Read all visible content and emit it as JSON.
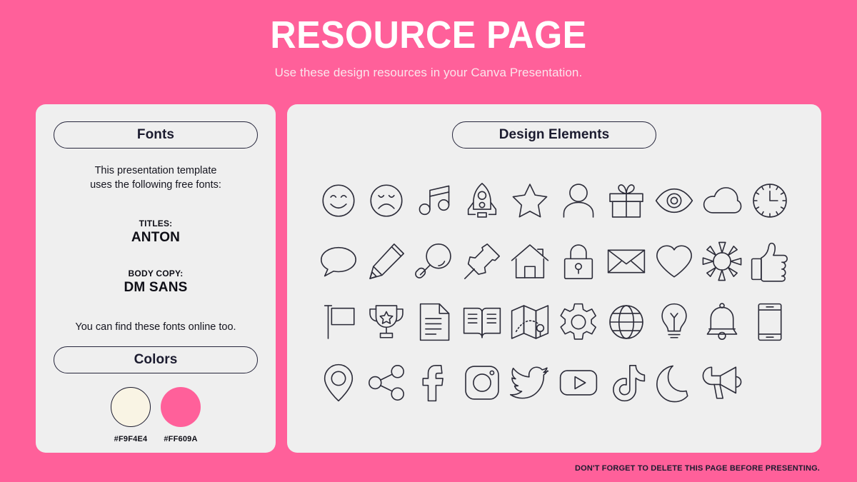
{
  "header": {
    "title": "RESOURCE PAGE",
    "subtitle": "Use these design resources in your Canva Presentation."
  },
  "fonts_panel": {
    "heading": "Fonts",
    "intro_line_1": "This presentation template",
    "intro_line_2": "uses the following free fonts:",
    "titles_label": "TITLES:",
    "titles_value": "ANTON",
    "body_label": "BODY COPY:",
    "body_value": "DM SANS",
    "outro": "You can find these fonts online too."
  },
  "colors_panel": {
    "heading": "Colors",
    "swatches": [
      {
        "hex": "#F9F4E4",
        "outlined": true
      },
      {
        "hex": "#FF609A",
        "outlined": false
      }
    ]
  },
  "design_panel": {
    "heading": "Design Elements",
    "icons": [
      "smiley-face-icon",
      "sad-face-icon",
      "music-note-icon",
      "rocket-icon",
      "star-icon",
      "user-icon",
      "gift-icon",
      "eye-icon",
      "cloud-icon",
      "clock-icon",
      "speech-bubble-icon",
      "pencil-icon",
      "magnifier-icon",
      "pushpin-icon",
      "house-icon",
      "lock-icon",
      "envelope-icon",
      "heart-icon",
      "sun-icon",
      "thumbs-up-icon",
      "flag-icon",
      "trophy-icon",
      "document-icon",
      "open-book-icon",
      "map-icon",
      "gear-icon",
      "globe-icon",
      "lightbulb-icon",
      "bell-icon",
      "mobile-phone-icon",
      "location-pin-icon",
      "share-icon",
      "facebook-icon",
      "instagram-icon",
      "twitter-icon",
      "youtube-icon",
      "tiktok-icon",
      "moon-icon",
      "megaphone-icon"
    ]
  },
  "footer": {
    "note": "DON'T FORGET TO DELETE THIS PAGE BEFORE PRESENTING."
  },
  "theme": {
    "background": "#FF609A",
    "card_background": "#EFEFEF",
    "ink": "#1B1B2F",
    "title_color": "#FFFFFF"
  }
}
